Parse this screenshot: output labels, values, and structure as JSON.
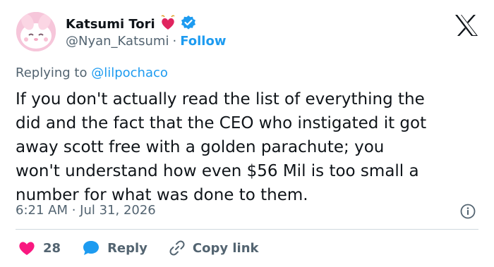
{
  "author": {
    "display_name": "Katsumi Tori",
    "handle": "@Nyan_Katsumi",
    "separator": "·",
    "follow_label": "Follow"
  },
  "reply_context": {
    "prefix": "Replying to",
    "mention": "@lilpochaco"
  },
  "tweet": {
    "text": "If you don't actually read the list of everything the\ndid and the fact that the CEO who instigated it got\naway scott free with a golden parachute; you\nwon't understand how even $56 Mil is too small a\nnumber for what was done to them.",
    "timestamp": "6:21 AM · Jul 31, 2026"
  },
  "actions": {
    "like_count": "28",
    "reply_label": "Reply",
    "copy_link_label": "Copy link"
  },
  "icons": {
    "heart": "heart-icon",
    "verified": "verified-badge-icon",
    "x_logo": "x-logo-icon",
    "info": "info-icon",
    "reply": "speech-bubble-icon",
    "link": "link-icon"
  },
  "colors": {
    "accent": "#1d9bf0",
    "like": "#f91880",
    "text": "#0f1419",
    "muted": "#536471",
    "divider": "#cfd9de"
  }
}
